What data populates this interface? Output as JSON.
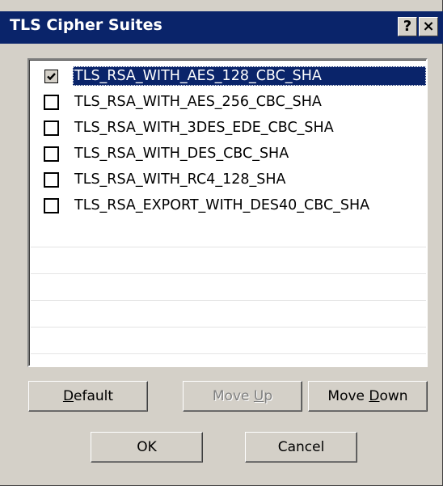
{
  "window": {
    "title": "TLS Cipher Suites",
    "help_glyph": "?",
    "close_glyph": "×"
  },
  "cipher_list": {
    "items": [
      {
        "label": "TLS_RSA_WITH_AES_128_CBC_SHA",
        "checked": true,
        "selected": true
      },
      {
        "label": "TLS_RSA_WITH_AES_256_CBC_SHA",
        "checked": false,
        "selected": false
      },
      {
        "label": "TLS_RSA_WITH_3DES_EDE_CBC_SHA",
        "checked": false,
        "selected": false
      },
      {
        "label": "TLS_RSA_WITH_DES_CBC_SHA",
        "checked": false,
        "selected": false
      },
      {
        "label": "TLS_RSA_WITH_RC4_128_SHA",
        "checked": false,
        "selected": false
      },
      {
        "label": "TLS_RSA_EXPORT_WITH_DES40_CBC_SHA",
        "checked": false,
        "selected": false
      }
    ]
  },
  "buttons": {
    "default": {
      "pre": "",
      "acc": "D",
      "post": "efault",
      "enabled": true
    },
    "move_up": {
      "pre": "Move ",
      "acc": "U",
      "post": "p",
      "enabled": false
    },
    "move_down": {
      "pre": "Move ",
      "acc": "D",
      "post": "own",
      "enabled": true
    },
    "ok": {
      "label": "OK"
    },
    "cancel": {
      "label": "Cancel"
    }
  },
  "colors": {
    "titlebar": "#0a246a",
    "dialog_face": "#d4d0c8",
    "selection": "#0a246a"
  }
}
